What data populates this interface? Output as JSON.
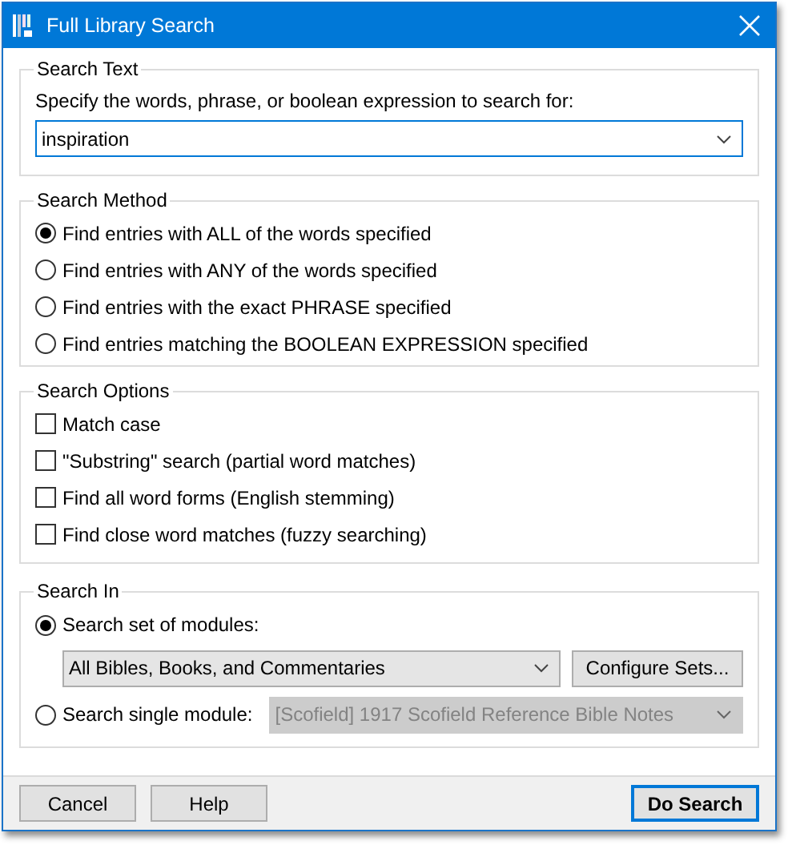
{
  "window": {
    "title": "Full Library Search"
  },
  "search_text": {
    "legend": "Search Text",
    "prompt": "Specify the words, phrase, or boolean expression to search for:",
    "field": {
      "value": "inspiration"
    }
  },
  "search_method": {
    "legend": "Search Method",
    "options": [
      {
        "label": "Find entries with ALL of the words specified",
        "selected": true
      },
      {
        "label": "Find entries with ANY of the words specified",
        "selected": false
      },
      {
        "label": "Find entries with the exact PHRASE specified",
        "selected": false
      },
      {
        "label": "Find entries matching the BOOLEAN EXPRESSION specified",
        "selected": false
      }
    ]
  },
  "search_options": {
    "legend": "Search Options",
    "options": [
      {
        "label": "Match case",
        "checked": false
      },
      {
        "label": "\"Substring\" search (partial word matches)",
        "checked": false
      },
      {
        "label": "Find all word forms (English stemming)",
        "checked": false
      },
      {
        "label": "Find close word matches (fuzzy searching)",
        "checked": false
      }
    ]
  },
  "search_in": {
    "legend": "Search In",
    "options": [
      {
        "kind": "set",
        "label": "Search set of modules:",
        "selected": true,
        "dropdown": {
          "value": "All Bibles, Books, and Commentaries",
          "disabled": false
        },
        "button": "Configure Sets..."
      },
      {
        "kind": "single",
        "label": "Search single module:",
        "selected": false,
        "dropdown": {
          "value": "[Scofield] 1917 Scofield Reference Bible Notes",
          "disabled": true
        }
      }
    ]
  },
  "buttons": [
    {
      "label": "Cancel",
      "default": false
    },
    {
      "label": "Help",
      "default": false
    },
    {
      "label": "Do Search",
      "default": true
    }
  ]
}
